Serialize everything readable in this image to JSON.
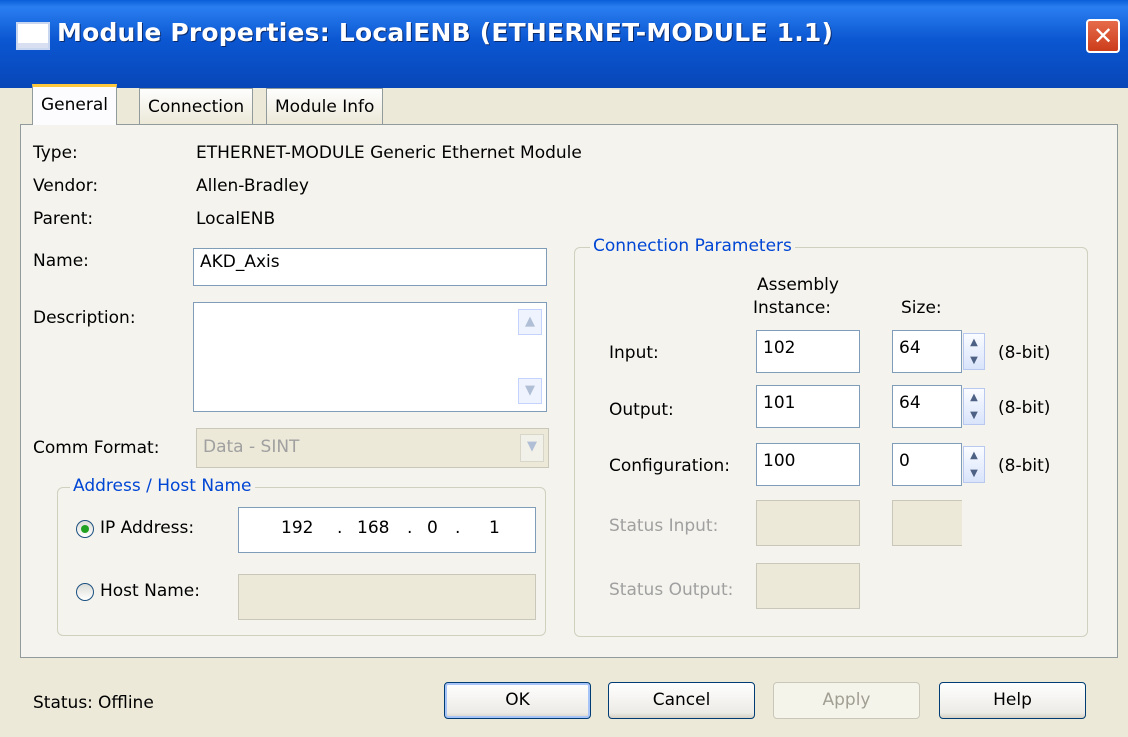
{
  "window": {
    "title": "Module Properties: LocalENB (ETHERNET-MODULE 1.1)",
    "close_glyph": "✕"
  },
  "tabs": [
    {
      "label": "General",
      "active": true
    },
    {
      "label": "Connection",
      "active": false
    },
    {
      "label": "Module Info",
      "active": false
    }
  ],
  "general": {
    "type_label": "Type:",
    "type_value": "ETHERNET-MODULE Generic Ethernet Module",
    "vendor_label": "Vendor:",
    "vendor_value": "Allen-Bradley",
    "parent_label": "Parent:",
    "parent_value": "LocalENB",
    "name_label": "Name:",
    "name_value": "AKD_Axis",
    "description_label": "Description:",
    "description_value": "",
    "comm_format_label": "Comm Format:",
    "comm_format_value": "Data - SINT"
  },
  "address": {
    "legend": "Address / Host Name",
    "ip_label": "IP Address:",
    "ip_selected": true,
    "ip_octets": [
      "192",
      "168",
      "0",
      "1"
    ],
    "host_label": "Host Name:",
    "host_value": ""
  },
  "connection_params": {
    "legend": "Connection Parameters",
    "col_assembly": "Assembly",
    "col_instance": "Instance:",
    "col_size": "Size:",
    "rows": [
      {
        "label": "Input:",
        "instance": "102",
        "size": "64",
        "unit": "(8-bit)",
        "enabled": true
      },
      {
        "label": "Output:",
        "instance": "101",
        "size": "64",
        "unit": "(8-bit)",
        "enabled": true
      },
      {
        "label": "Configuration:",
        "instance": "100",
        "size": "0",
        "unit": "(8-bit)",
        "enabled": true
      },
      {
        "label": "Status Input:",
        "instance": "",
        "size": "",
        "unit": "",
        "enabled": false
      },
      {
        "label": "Status Output:",
        "instance": "",
        "size": "",
        "unit": "",
        "enabled": false
      }
    ]
  },
  "footer": {
    "status_label": "Status:",
    "status_value": "Offline",
    "ok": "OK",
    "cancel": "Cancel",
    "apply": "Apply",
    "help": "Help"
  },
  "colors": {
    "titlebar": "#0b57d2",
    "dialog_bg": "#ece9d8",
    "group_text": "#0046d5",
    "tab_highlight": "#ffc83c"
  }
}
